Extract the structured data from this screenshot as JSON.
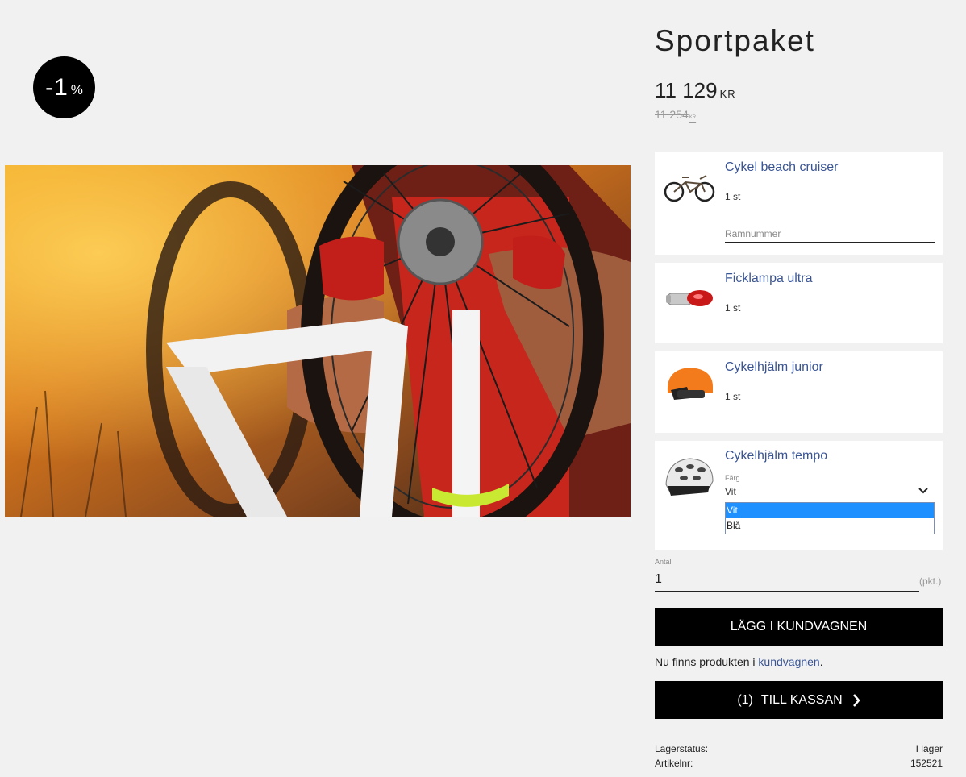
{
  "badge": {
    "number": "-1",
    "suffix": "%"
  },
  "product": {
    "title": "Sportpaket",
    "price": "11 129",
    "currency": "KR",
    "old_price": "11 254",
    "old_currency": "KR"
  },
  "items": [
    {
      "name": "Cykel beach cruiser",
      "qty": "1 st",
      "frame_placeholder": "Ramnummer"
    },
    {
      "name": "Ficklampa ultra",
      "qty": "1 st"
    },
    {
      "name": "Cykelhjälm junior",
      "qty": "1 st"
    },
    {
      "name": "Cykelhjälm tempo",
      "color_label": "Färg",
      "color_value": "Vit",
      "options": [
        "Vit",
        "Blå"
      ]
    }
  ],
  "quantity": {
    "label": "Antal",
    "value": "1",
    "unit": "(pkt.)"
  },
  "add_button": "LÄGG I KUNDVAGNEN",
  "cart_note": {
    "text": "Nu finns produkten i",
    "link": "kundvagnen",
    "end": "."
  },
  "checkout": {
    "count": "(1)",
    "label": "TILL KASSAN"
  },
  "meta": {
    "stock_label": "Lagerstatus:",
    "stock_value": "I lager",
    "article_label": "Artikelnr:",
    "article_value": "152521"
  },
  "colors": {
    "accent_link": "#3a5594",
    "button_bg": "#000000",
    "select_highlight": "#1e90ff"
  }
}
